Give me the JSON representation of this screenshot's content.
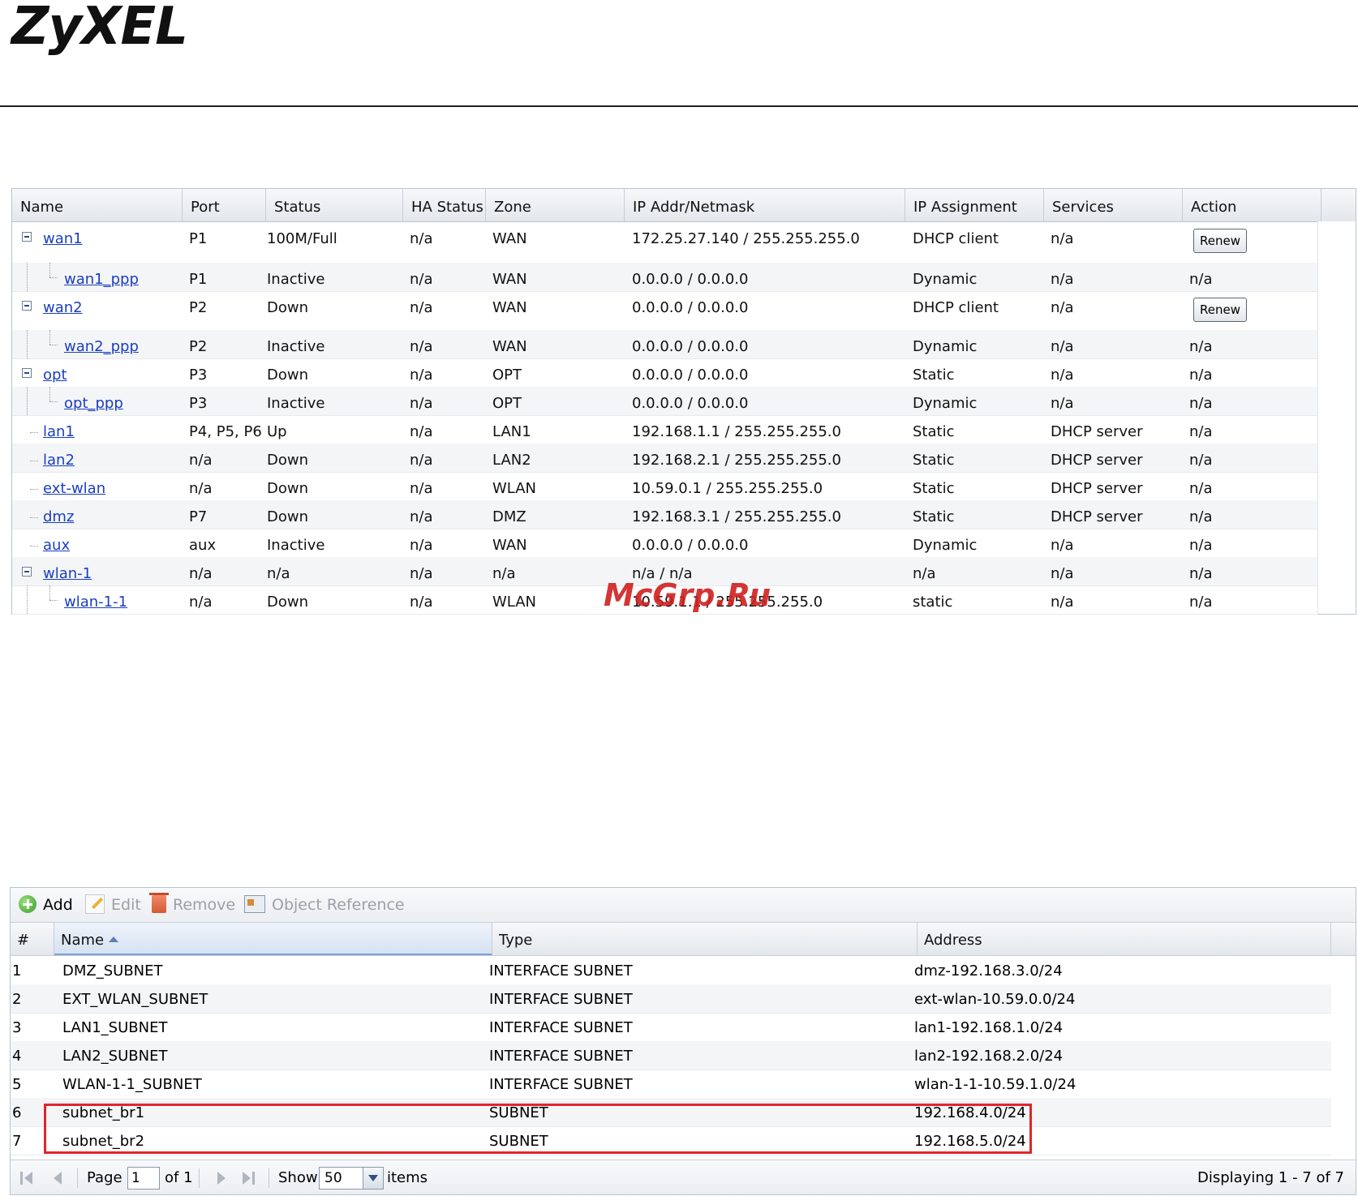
{
  "brand": {
    "logo_text": "ZyXEL"
  },
  "interfaces": {
    "columns": [
      "Name",
      "Port",
      "Status",
      "HA Status",
      "Zone",
      "IP Addr/Netmask",
      "IP Assignment",
      "Services",
      "Action"
    ],
    "rows": [
      {
        "name": "wan1",
        "port": "P1",
        "status": "100M/Full",
        "ha": "n/a",
        "zone": "WAN",
        "ip": "172.25.27.140 / 255.255.255.0",
        "assign": "DHCP client",
        "services": "n/a",
        "action": "Renew",
        "level": 0,
        "expandable": true
      },
      {
        "name": "wan1_ppp",
        "port": "P1",
        "status": "Inactive",
        "ha": "n/a",
        "zone": "WAN",
        "ip": "0.0.0.0 / 0.0.0.0",
        "assign": "Dynamic",
        "services": "n/a",
        "action": "n/a",
        "level": 1,
        "expandable": false
      },
      {
        "name": "wan2",
        "port": "P2",
        "status": "Down",
        "ha": "n/a",
        "zone": "WAN",
        "ip": "0.0.0.0 / 0.0.0.0",
        "assign": "DHCP client",
        "services": "n/a",
        "action": "Renew",
        "level": 0,
        "expandable": true
      },
      {
        "name": "wan2_ppp",
        "port": "P2",
        "status": "Inactive",
        "ha": "n/a",
        "zone": "WAN",
        "ip": "0.0.0.0 / 0.0.0.0",
        "assign": "Dynamic",
        "services": "n/a",
        "action": "n/a",
        "level": 1,
        "expandable": false
      },
      {
        "name": "opt",
        "port": "P3",
        "status": "Down",
        "ha": "n/a",
        "zone": "OPT",
        "ip": "0.0.0.0 / 0.0.0.0",
        "assign": "Static",
        "services": "n/a",
        "action": "n/a",
        "level": 0,
        "expandable": true
      },
      {
        "name": "opt_ppp",
        "port": "P3",
        "status": "Inactive",
        "ha": "n/a",
        "zone": "OPT",
        "ip": "0.0.0.0 / 0.0.0.0",
        "assign": "Dynamic",
        "services": "n/a",
        "action": "n/a",
        "level": 1,
        "expandable": false
      },
      {
        "name": "lan1",
        "port": "P4, P5, P6",
        "status": "Up",
        "ha": "n/a",
        "zone": "LAN1",
        "ip": "192.168.1.1 / 255.255.255.0",
        "assign": "Static",
        "services": "DHCP server",
        "action": "n/a",
        "level": 0,
        "expandable": false
      },
      {
        "name": "lan2",
        "port": "n/a",
        "status": "Down",
        "ha": "n/a",
        "zone": "LAN2",
        "ip": "192.168.2.1 / 255.255.255.0",
        "assign": "Static",
        "services": "DHCP server",
        "action": "n/a",
        "level": 0,
        "expandable": false
      },
      {
        "name": "ext-wlan",
        "port": "n/a",
        "status": "Down",
        "ha": "n/a",
        "zone": "WLAN",
        "ip": "10.59.0.1 / 255.255.255.0",
        "assign": "Static",
        "services": "DHCP server",
        "action": "n/a",
        "level": 0,
        "expandable": false
      },
      {
        "name": "dmz",
        "port": "P7",
        "status": "Down",
        "ha": "n/a",
        "zone": "DMZ",
        "ip": "192.168.3.1 / 255.255.255.0",
        "assign": "Static",
        "services": "DHCP server",
        "action": "n/a",
        "level": 0,
        "expandable": false
      },
      {
        "name": "aux",
        "port": "aux",
        "status": "Inactive",
        "ha": "n/a",
        "zone": "WAN",
        "ip": "0.0.0.0 / 0.0.0.0",
        "assign": "Dynamic",
        "services": "n/a",
        "action": "n/a",
        "level": 0,
        "expandable": false
      },
      {
        "name": "wlan-1",
        "port": "n/a",
        "status": "n/a",
        "ha": "n/a",
        "zone": "n/a",
        "ip": "n/a / n/a",
        "assign": "n/a",
        "services": "n/a",
        "action": "n/a",
        "level": 0,
        "expandable": true
      },
      {
        "name": "wlan-1-1",
        "port": "n/a",
        "status": "Down",
        "ha": "n/a",
        "zone": "WLAN",
        "ip": "10.59.1.1 / 255.255.255.0",
        "assign": "static",
        "services": "n/a",
        "action": "n/a",
        "level": 1,
        "expandable": false
      }
    ]
  },
  "watermark": "McGrp.Ru",
  "address_objects": {
    "toolbar": {
      "add": "Add",
      "edit": "Edit",
      "remove": "Remove",
      "object_reference": "Object Reference"
    },
    "columns": [
      "#",
      "Name",
      "Type",
      "Address"
    ],
    "sorted_column": "Name",
    "rows": [
      {
        "num": "1",
        "name": "DMZ_SUBNET",
        "type": "INTERFACE SUBNET",
        "address": "dmz-192.168.3.0/24"
      },
      {
        "num": "2",
        "name": "EXT_WLAN_SUBNET",
        "type": "INTERFACE SUBNET",
        "address": "ext-wlan-10.59.0.0/24"
      },
      {
        "num": "3",
        "name": "LAN1_SUBNET",
        "type": "INTERFACE SUBNET",
        "address": "lan1-192.168.1.0/24"
      },
      {
        "num": "4",
        "name": "LAN2_SUBNET",
        "type": "INTERFACE SUBNET",
        "address": "lan2-192.168.2.0/24"
      },
      {
        "num": "5",
        "name": "WLAN-1-1_SUBNET",
        "type": "INTERFACE SUBNET",
        "address": "wlan-1-1-10.59.1.0/24"
      },
      {
        "num": "6",
        "name": "subnet_br1",
        "type": "SUBNET",
        "address": "192.168.4.0/24"
      },
      {
        "num": "7",
        "name": "subnet_br2",
        "type": "SUBNET",
        "address": "192.168.5.0/24"
      }
    ],
    "pager": {
      "page_label": "Page",
      "page_value": "1",
      "of_label": "of 1",
      "show_label": "Show",
      "show_value": "50",
      "items_label": "items",
      "display_text": "Displaying 1 - 7 of 7"
    }
  }
}
